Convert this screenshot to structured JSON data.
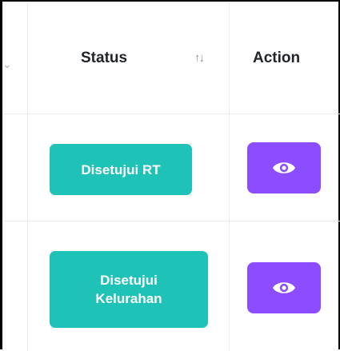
{
  "table": {
    "columns": {
      "status": "Status",
      "action": "Action"
    },
    "sort_icon": "sort-arrows-icon",
    "rows": [
      {
        "status": "Disetujui RT",
        "action_icon": "eye-icon"
      },
      {
        "status": "Disetujui\nKelurahan",
        "action_icon": "eye-icon"
      }
    ]
  },
  "colors": {
    "status_badge": "#1fc2b6",
    "view_button": "#8b4dff",
    "border": "#ececec"
  }
}
